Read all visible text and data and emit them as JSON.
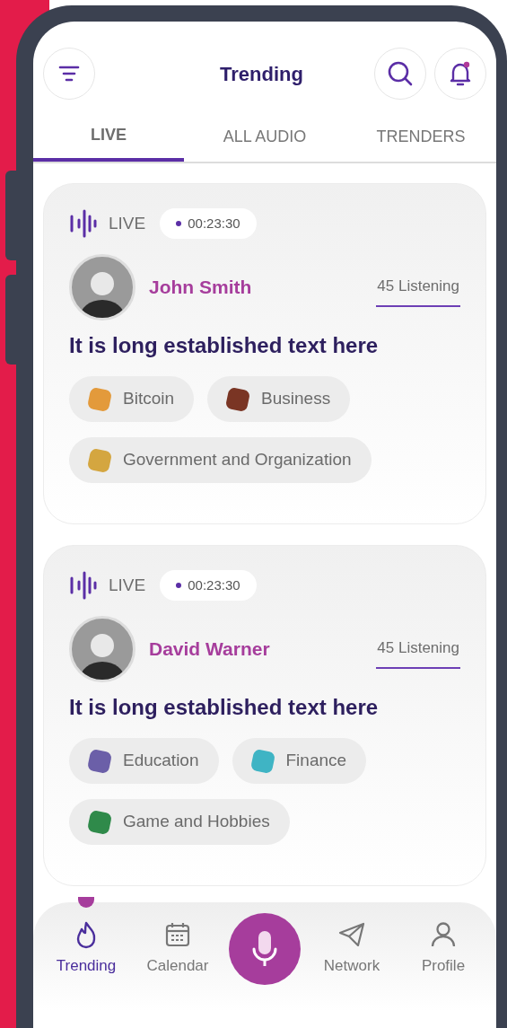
{
  "header": {
    "title": "Trending"
  },
  "tabs": [
    {
      "label": "LIVE",
      "selected": true
    },
    {
      "label": "ALL AUDIO",
      "selected": false
    },
    {
      "label": "TRENDERS",
      "selected": false
    }
  ],
  "posts": [
    {
      "status": "LIVE",
      "duration": "00:23:30",
      "host": "John Smith",
      "listeners": "45 Listening",
      "title": "It is long established text here",
      "tags": [
        "Bitcoin",
        "Business",
        "Government and Organization"
      ]
    },
    {
      "status": "LIVE",
      "duration": "00:23:30",
      "host": "David Warner",
      "listeners": "45 Listening",
      "title": "It is long established text here",
      "tags": [
        "Education",
        "Finance",
        "Game and Hobbies"
      ]
    }
  ],
  "nav": [
    {
      "label": "Trending",
      "selected": true
    },
    {
      "label": "Calendar",
      "selected": false
    },
    {
      "label": "Network",
      "selected": false
    },
    {
      "label": "Profile",
      "selected": false
    }
  ]
}
